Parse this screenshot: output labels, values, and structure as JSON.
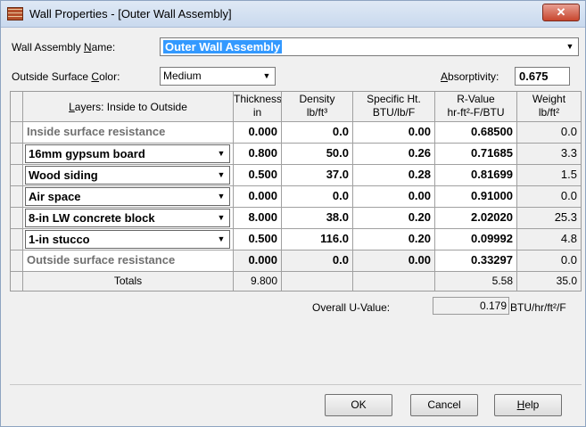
{
  "window": {
    "title": "Wall Properties - [Outer Wall Assembly]",
    "close_label": "✕"
  },
  "form": {
    "assembly_name_label_pre": "Wall Assembly ",
    "assembly_name_label_ul": "N",
    "assembly_name_label_post": "ame:",
    "assembly_name_value": "Outer Wall Assembly",
    "surface_color_label_pre": "Outside Surface ",
    "surface_color_label_ul": "C",
    "surface_color_label_post": "olor:",
    "surface_color_value": "Medium",
    "absorptivity_label_ul": "A",
    "absorptivity_label_post": "bsorptivity:",
    "absorptivity_value": "0.675"
  },
  "table": {
    "headers": {
      "layers_pre": "",
      "layers_ul": "L",
      "layers_post": "ayers: Inside to Outside",
      "thickness": "Thickness",
      "thickness_unit": "in",
      "density": "Density",
      "density_unit": "lb/ft³",
      "specific": "Specific Ht.",
      "specific_unit": "BTU/lb/F",
      "rvalue": "R-Value",
      "rvalue_unit": "hr-ft²-F/BTU",
      "weight": "Weight",
      "weight_unit": "lb/ft²"
    },
    "rows": [
      {
        "name": "Inside surface resistance",
        "thickness": "0.000",
        "density": "0.0",
        "specific": "0.00",
        "rvalue": "0.68500",
        "weight": "0.0"
      },
      {
        "name": "16mm gypsum board",
        "thickness": "0.800",
        "density": "50.0",
        "specific": "0.26",
        "rvalue": "0.71685",
        "weight": "3.3"
      },
      {
        "name": "Wood siding",
        "thickness": "0.500",
        "density": "37.0",
        "specific": "0.28",
        "rvalue": "0.81699",
        "weight": "1.5"
      },
      {
        "name": "Air space",
        "thickness": "0.000",
        "density": "0.0",
        "specific": "0.00",
        "rvalue": "0.91000",
        "weight": "0.0"
      },
      {
        "name": "8-in LW concrete block",
        "thickness": "8.000",
        "density": "38.0",
        "specific": "0.20",
        "rvalue": "2.02020",
        "weight": "25.3"
      },
      {
        "name": "1-in stucco",
        "thickness": "0.500",
        "density": "116.0",
        "specific": "0.20",
        "rvalue": "0.09992",
        "weight": "4.8"
      },
      {
        "name": "Outside surface resistance",
        "thickness": "0.000",
        "density": "0.0",
        "specific": "0.00",
        "rvalue": "0.33297",
        "weight": "0.0"
      }
    ],
    "totals": {
      "label": "Totals",
      "thickness": "9.800",
      "rvalue": "5.58",
      "weight": "35.0"
    }
  },
  "uvalue": {
    "label": "Overall U-Value:",
    "value": "0.179",
    "unit": "BTU/hr/ft²/F"
  },
  "buttons": {
    "ok": "OK",
    "cancel": "Cancel",
    "help_ul": "H",
    "help_post": "elp"
  },
  "colors": {
    "selection": "#3399ff",
    "close": "#c7462d"
  }
}
